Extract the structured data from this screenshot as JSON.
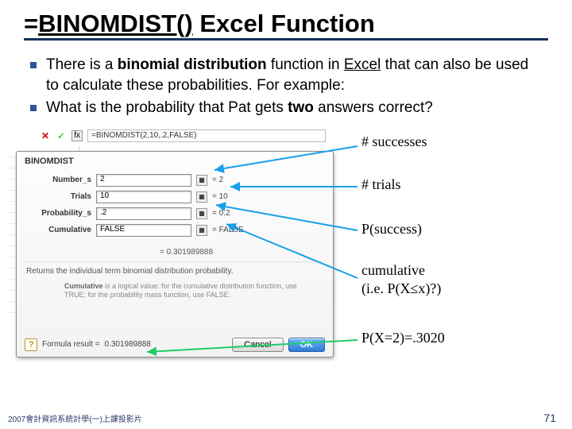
{
  "title": {
    "prefix": "=",
    "func": "BINOMDIST()",
    "rest": " Excel Function"
  },
  "bullets": [
    {
      "pre": "There is a ",
      "b1": "binomial distribution",
      "mid": " function in ",
      "u1": "Excel",
      "post": " that can also be used to calculate these probabilities. For example:"
    },
    {
      "pre": "What is the probability that Pat gets ",
      "b1": "two",
      "mid": "",
      "u1": "",
      "post": " answers correct?"
    }
  ],
  "formula_bar": {
    "formula": "=BINOMDIST(2,10,.2,FALSE)"
  },
  "dialog": {
    "section": "BINOMDIST",
    "args": [
      {
        "label": "Number_s",
        "value": "2",
        "resolved": "= 2"
      },
      {
        "label": "Trials",
        "value": "10",
        "resolved": "= 10"
      },
      {
        "label": "Probability_s",
        "value": ".2",
        "resolved": "= 0.2"
      },
      {
        "label": "Cumulative",
        "value": "FALSE",
        "resolved": "= FALSE"
      }
    ],
    "big_resolved": "= 0.301989888",
    "desc1": "Returns the individual term binomial distribution probability.",
    "desc2_lead": "Cumulative",
    "desc2_body": " is a logical value: for the cumulative distribution function, use TRUE; for the probability mass function, use FALSE.",
    "formula_result_label": "Formula result =",
    "formula_result_val": "0.301989888",
    "cancel": "Cancel",
    "ok": "OK"
  },
  "annotations": {
    "a1": "# successes",
    "a2": "# trials",
    "a3": "P(success)",
    "a4a": "cumulative",
    "a4b": "(i.e. P(X≤x)?)",
    "a5": "P(X=2)=.3020"
  },
  "footer": {
    "left": "2007會計資訊系統計學(一)上課投影片",
    "right": "71"
  }
}
